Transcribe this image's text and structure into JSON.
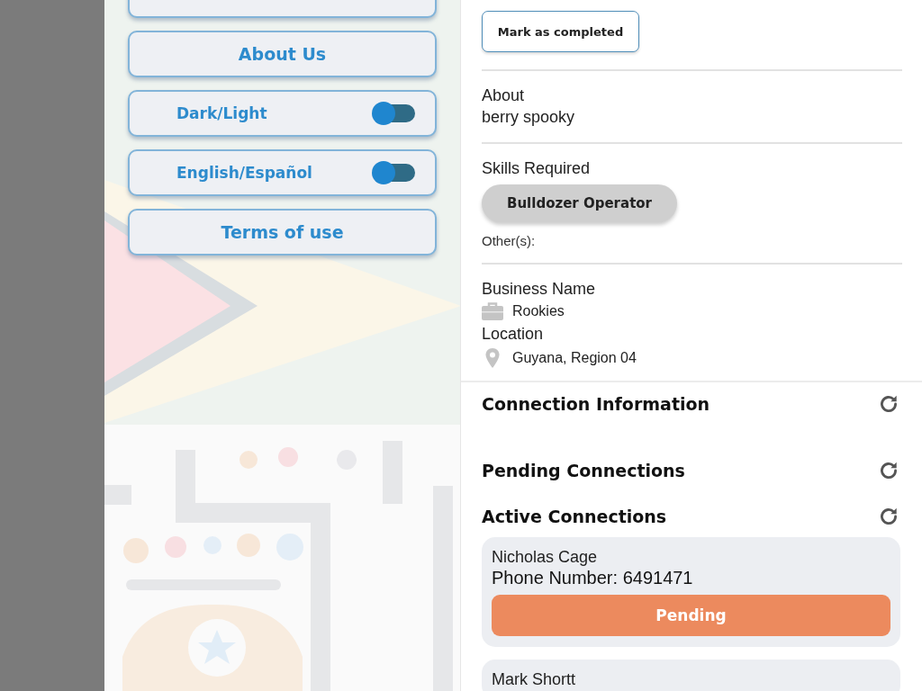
{
  "side_menu": {
    "items": [
      {
        "kind": "button",
        "label": "About Us"
      },
      {
        "kind": "toggle",
        "label": "Dark/Light",
        "on": false
      },
      {
        "kind": "toggle",
        "label": "English/Español",
        "on": false
      },
      {
        "kind": "button",
        "label": "Terms of use"
      }
    ]
  },
  "details": {
    "mark_button": "Mark as completed",
    "about": {
      "label": "About",
      "value": "berry spooky"
    },
    "skills": {
      "label": "Skills Required",
      "chips": [
        "Bulldozer Operator"
      ],
      "others_label": "Other(s):"
    },
    "business": {
      "label": "Business Name",
      "value": "Rookies"
    },
    "location": {
      "label": "Location",
      "value": "Guyana, Region 04"
    }
  },
  "connections": {
    "sections": [
      {
        "title": "Connection Information"
      },
      {
        "title": "Pending Connections"
      },
      {
        "title": "Active Connections"
      }
    ],
    "cards": [
      {
        "name": "Nicholas Cage",
        "phone": "Phone Number: 6491471",
        "status": "Pending"
      },
      {
        "name": "Mark Shortt"
      }
    ]
  }
}
